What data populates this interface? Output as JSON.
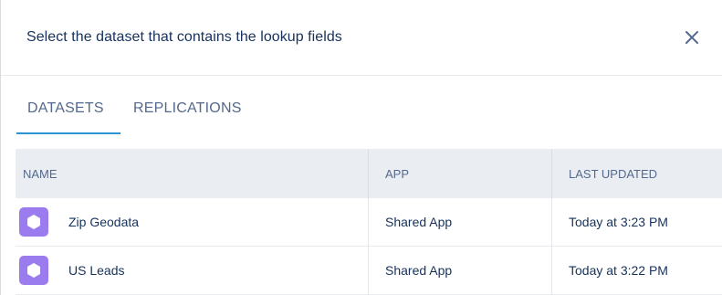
{
  "header": {
    "title": "Select the dataset that contains the lookup fields",
    "close_icon": "close-icon"
  },
  "tabs": [
    {
      "label": "DATASETS",
      "active": true
    },
    {
      "label": "REPLICATIONS",
      "active": false
    }
  ],
  "table": {
    "columns": [
      "NAME",
      "APP",
      "LAST UPDATED"
    ],
    "rows": [
      {
        "icon": "dataset-icon",
        "name": "Zip Geodata",
        "app": "Shared App",
        "last_updated": "Today at 3:23 PM"
      },
      {
        "icon": "dataset-icon",
        "name": "US Leads",
        "app": "Shared App",
        "last_updated": "Today at 3:22 PM"
      }
    ]
  },
  "colors": {
    "accent": "#2a94d6",
    "dataset_icon": "#9b7cef",
    "header_bg": "#eaeef3",
    "text": "#16325c",
    "muted": "#54698d"
  }
}
